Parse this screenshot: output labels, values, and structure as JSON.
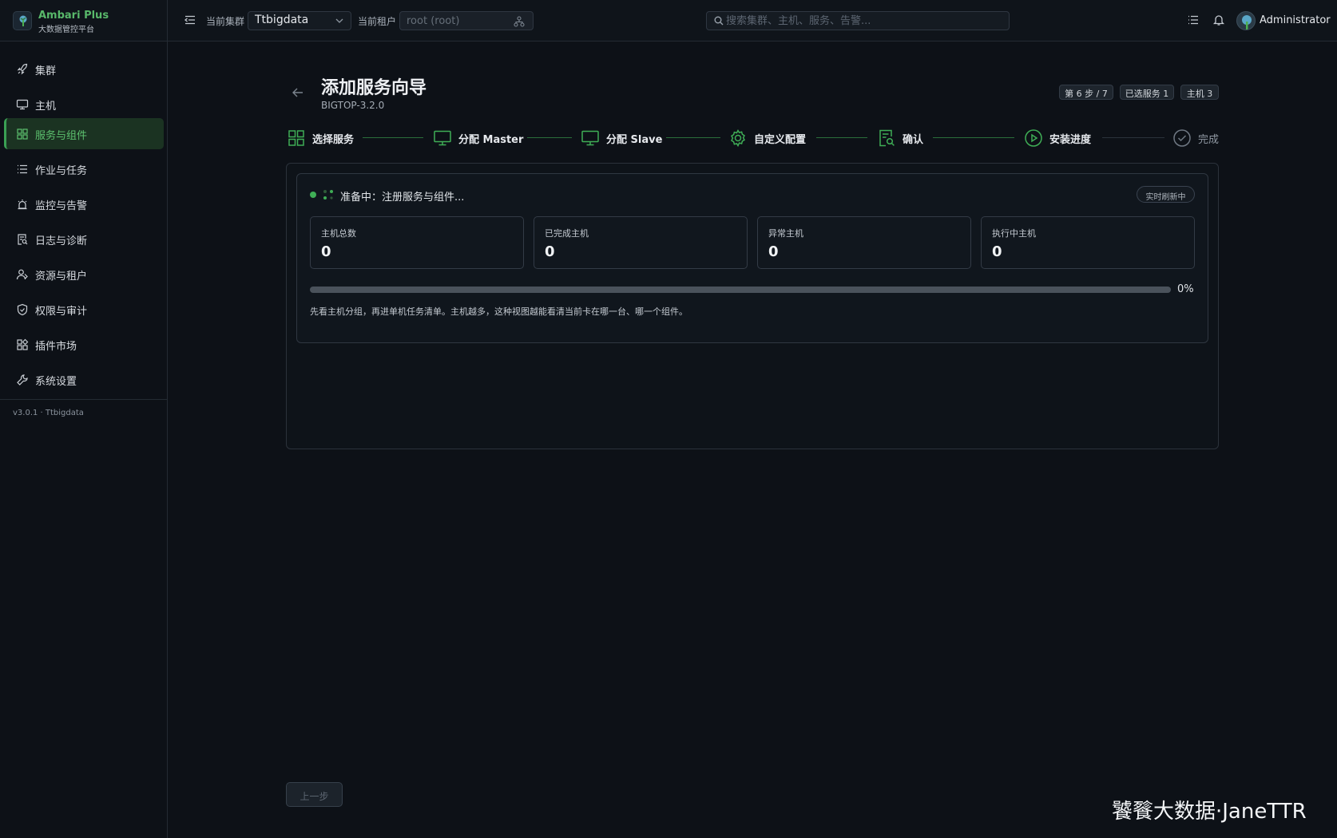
{
  "brand": {
    "title": "Ambari Plus",
    "subtitle": "大数据管控平台"
  },
  "header": {
    "cluster_label": "当前集群",
    "cluster_value": "Ttbigdata",
    "tenant_label": "当前租户",
    "tenant_value": "root (root)",
    "search_placeholder": "搜索集群、主机、服务、告警...",
    "user_name": "Administrator"
  },
  "sidebar": {
    "items": [
      {
        "label": "集群",
        "icon": "rocket-icon",
        "active": false
      },
      {
        "label": "主机",
        "icon": "monitor-icon",
        "active": false
      },
      {
        "label": "服务与组件",
        "icon": "grid-icon",
        "active": true
      },
      {
        "label": "作业与任务",
        "icon": "list-icon",
        "active": false
      },
      {
        "label": "监控与告警",
        "icon": "alarm-icon",
        "active": false
      },
      {
        "label": "日志与诊断",
        "icon": "log-search-icon",
        "active": false
      },
      {
        "label": "资源与租户",
        "icon": "users-icon",
        "active": false
      },
      {
        "label": "权限与审计",
        "icon": "shield-icon",
        "active": false
      },
      {
        "label": "插件市场",
        "icon": "apps-icon",
        "active": false
      },
      {
        "label": "系统设置",
        "icon": "wrench-icon",
        "active": false
      }
    ],
    "version": "v3.0.1 · Ttbigdata"
  },
  "page": {
    "title": "添加服务向导",
    "subtitle": "BIGTOP-3.2.0",
    "badges": [
      "第 6 步 / 7",
      "已选服务 1",
      "主机 3"
    ]
  },
  "steps": [
    {
      "label": "选择服务",
      "icon": "grid-icon",
      "state": "done"
    },
    {
      "label": "分配 Master",
      "icon": "monitor-icon",
      "state": "done"
    },
    {
      "label": "分配 Slave",
      "icon": "monitor-icon",
      "state": "done"
    },
    {
      "label": "自定义配置",
      "icon": "gear-icon",
      "state": "done"
    },
    {
      "label": "确认",
      "icon": "document-search-icon",
      "state": "done"
    },
    {
      "label": "安装进度",
      "icon": "play-circle-icon",
      "state": "active"
    },
    {
      "label": "完成",
      "icon": "check-circle-icon",
      "state": "pending"
    }
  ],
  "progress_panel": {
    "status_text": "准备中：注册服务与组件...",
    "live_badge": "实时刷新中",
    "stats": [
      {
        "label": "主机总数",
        "value": "0"
      },
      {
        "label": "已完成主机",
        "value": "0"
      },
      {
        "label": "异常主机",
        "value": "0"
      },
      {
        "label": "执行中主机",
        "value": "0"
      }
    ],
    "progress_percent": 0,
    "progress_text": "0%",
    "hint": "先看主机分组，再进单机任务清单。主机越多，这种视图越能看清当前卡在哪一台、哪一个组件。"
  },
  "footer": {
    "prev_label": "上一步"
  },
  "watermark": "饕餮大数据·JaneTTR",
  "colors": {
    "accent": "#3fae56",
    "background": "#0d1117",
    "active_nav_bg": "#1b3322"
  }
}
